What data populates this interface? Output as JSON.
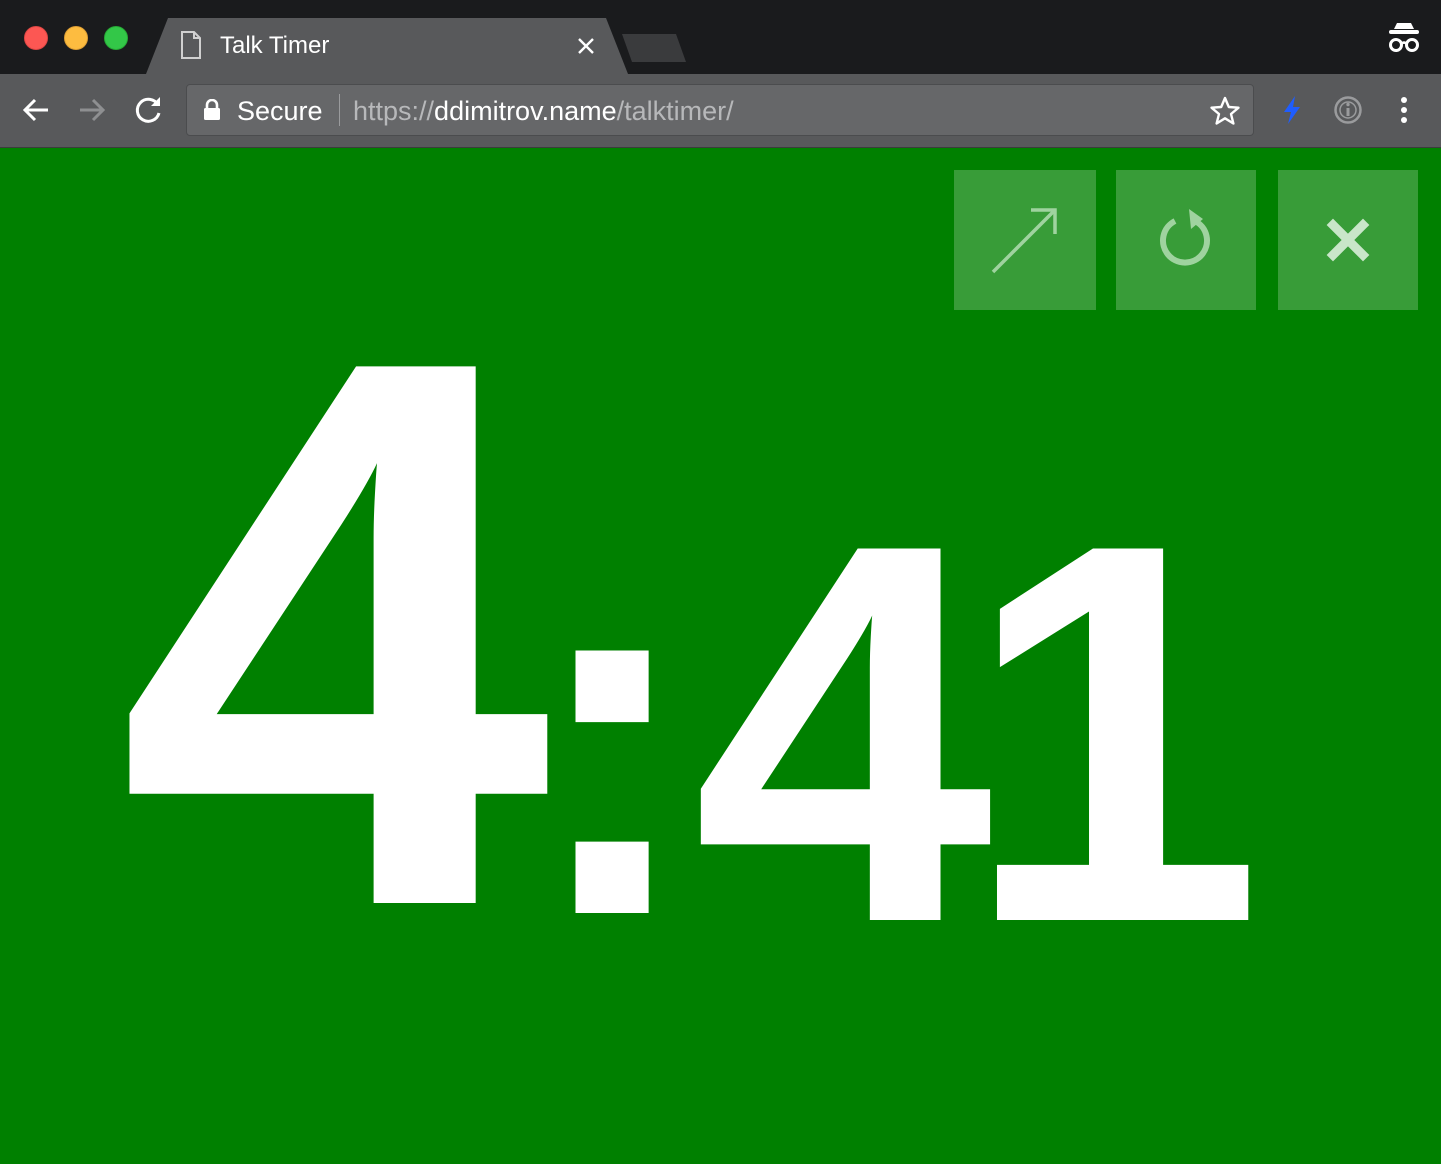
{
  "browser": {
    "tab": {
      "title": "Talk Timer"
    },
    "omnibox": {
      "security_label": "Secure",
      "url_scheme": "https://",
      "url_host": "ddimitrov.name",
      "url_path": "/talktimer/"
    },
    "icons": [
      "page-icon",
      "close-icon",
      "incognito-icon",
      "back-arrow-icon",
      "forward-arrow-icon",
      "reload-icon",
      "lock-icon",
      "star-icon",
      "bolt-icon",
      "info-icon",
      "kebab-menu-icon"
    ]
  },
  "timer": {
    "minutes": "4",
    "separator": ":",
    "seconds": "41",
    "background_color": "#008000",
    "text_color": "#ffffff"
  },
  "controls": [
    {
      "name": "expand-button",
      "icon": "diagonal-arrow-icon"
    },
    {
      "name": "reset-button",
      "icon": "restart-icon"
    },
    {
      "name": "close-button",
      "icon": "x-icon"
    }
  ]
}
